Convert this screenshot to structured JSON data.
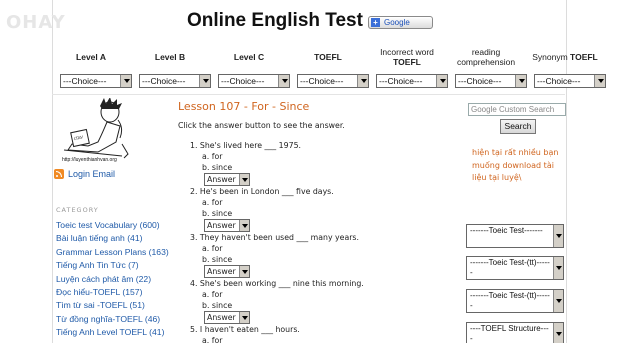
{
  "watermark": "OHAY",
  "header": {
    "title": "Online English Test",
    "google_button": "Google"
  },
  "nav": [
    {
      "label": "Level A",
      "select": "---Choice---"
    },
    {
      "label": "Level B",
      "select": "---Choice---"
    },
    {
      "label": "Level C",
      "select": "---Choice---"
    },
    {
      "label": "TOEFL",
      "select": "---Choice---"
    },
    {
      "label_line1": "Incorrect word",
      "label_line2": "TOEFL",
      "select": "---Choice---"
    },
    {
      "label_line1": "reading",
      "label_line2": "comprehension",
      "select": "---Choice---"
    },
    {
      "label_plain": "Synonym",
      "label_bold": "TOEFL",
      "select": "---Choice---"
    }
  ],
  "sidebar": {
    "logo_url": "http://luyenthianhvan.org",
    "login": "Login Email",
    "category_title": "CATEGORY",
    "categories": [
      "Toeic test Vocabulary (600)",
      "Bài luận tiếng anh (41)",
      "Grammar Lesson Plans (163)",
      "Tiếng Anh Tin Tức (7)",
      "Luyện cách phát âm (22)",
      "Đọc hiểu-TOEFL (157)",
      "Tìm từ sai -TOEFL (51)",
      "Từ đồng nghĩa-TOEFL (46)",
      "Tiếng Anh Level TOEFL (41)"
    ]
  },
  "main": {
    "lesson_title": "Lesson 107 - For - Since",
    "instruction": "Click the answer button to see the answer.",
    "answer_label": "Answer",
    "questions": [
      {
        "text": "1.   She's lived here ___ 1975.",
        "a": "a. for",
        "b": "b. since"
      },
      {
        "text": "2.   He's been in London ___ five days.",
        "a": "a. for",
        "b": "b. since"
      },
      {
        "text": "3.   They haven't been used ___ many years.",
        "a": "a. for",
        "b": "b. since"
      },
      {
        "text": "4.   She's been working ___ nine this morning.",
        "a": "a. for",
        "b": "b. since"
      },
      {
        "text": "5.   I haven't eaten ___ hours.",
        "a": "a. for"
      }
    ]
  },
  "right": {
    "search_placeholder": "Google Custom Search",
    "search_button": "Search",
    "promo": "hiện tại rất nhiều bạn muống download tài liệu tại luyệ\\",
    "selects": [
      "-------Toeic Test-------",
      "-------Toeic Test-(tt)------",
      "-------Toeic Test-(tt)------",
      "----TOEFL Structure----"
    ]
  }
}
